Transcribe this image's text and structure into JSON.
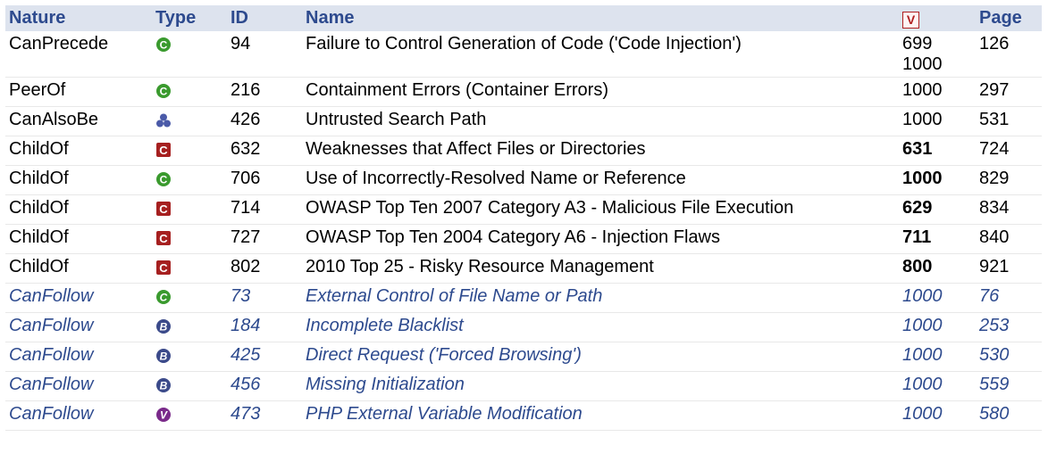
{
  "headers": {
    "nature": "Nature",
    "type": "Type",
    "id": "ID",
    "name": "Name",
    "view_icon": "V",
    "page": "Page"
  },
  "colors": {
    "header_bg": "#dde3ee",
    "header_text": "#2d4a8e",
    "inferred_text": "#2d4a8e",
    "class_icon": "#3a9a2e",
    "category_icon": "#a62020",
    "compound_icon": "#4a5aa8",
    "base_icon": "#3b4a8a",
    "variant_icon": "#7a2a8a"
  },
  "rows": [
    {
      "nature": "CanPrecede",
      "type_icon": "class-icon",
      "id": "94",
      "name": "Failure to Control Generation of Code ('Code Injection')",
      "views": [
        "699",
        "1000"
      ],
      "view_bold": false,
      "page": "126",
      "inferred": false
    },
    {
      "nature": "PeerOf",
      "type_icon": "class-icon",
      "id": "216",
      "name": "Containment Errors (Container Errors)",
      "views": [
        "1000"
      ],
      "view_bold": false,
      "page": "297",
      "inferred": false
    },
    {
      "nature": "CanAlsoBe",
      "type_icon": "compound-icon",
      "id": "426",
      "name": "Untrusted Search Path",
      "views": [
        "1000"
      ],
      "view_bold": false,
      "page": "531",
      "inferred": false
    },
    {
      "nature": "ChildOf",
      "type_icon": "category-icon",
      "id": "632",
      "name": "Weaknesses that Affect Files or Directories",
      "views": [
        "631"
      ],
      "view_bold": true,
      "page": "724",
      "inferred": false
    },
    {
      "nature": "ChildOf",
      "type_icon": "class-icon",
      "id": "706",
      "name": "Use of Incorrectly-Resolved Name or Reference",
      "views": [
        "1000"
      ],
      "view_bold": true,
      "page": "829",
      "inferred": false
    },
    {
      "nature": "ChildOf",
      "type_icon": "category-icon",
      "id": "714",
      "name": "OWASP Top Ten 2007 Category A3 - Malicious File Execution",
      "views": [
        "629"
      ],
      "view_bold": true,
      "page": "834",
      "inferred": false
    },
    {
      "nature": "ChildOf",
      "type_icon": "category-icon",
      "id": "727",
      "name": "OWASP Top Ten 2004 Category A6 - Injection Flaws",
      "views": [
        "711"
      ],
      "view_bold": true,
      "page": "840",
      "inferred": false
    },
    {
      "nature": "ChildOf",
      "type_icon": "category-icon",
      "id": "802",
      "name": "2010 Top 25 - Risky Resource Management",
      "views": [
        "800"
      ],
      "view_bold": true,
      "page": "921",
      "inferred": false
    },
    {
      "nature": "CanFollow",
      "type_icon": "class-icon",
      "id": "73",
      "name": "External Control of File Name or Path",
      "views": [
        "1000"
      ],
      "view_bold": false,
      "page": "76",
      "inferred": true
    },
    {
      "nature": "CanFollow",
      "type_icon": "base-icon",
      "id": "184",
      "name": "Incomplete Blacklist",
      "views": [
        "1000"
      ],
      "view_bold": false,
      "page": "253",
      "inferred": true
    },
    {
      "nature": "CanFollow",
      "type_icon": "base-icon",
      "id": "425",
      "name": "Direct Request ('Forced Browsing')",
      "views": [
        "1000"
      ],
      "view_bold": false,
      "page": "530",
      "inferred": true
    },
    {
      "nature": "CanFollow",
      "type_icon": "base-icon",
      "id": "456",
      "name": "Missing Initialization",
      "views": [
        "1000"
      ],
      "view_bold": false,
      "page": "559",
      "inferred": true
    },
    {
      "nature": "CanFollow",
      "type_icon": "variant-icon",
      "id": "473",
      "name": "PHP External Variable Modification",
      "views": [
        "1000"
      ],
      "view_bold": false,
      "page": "580",
      "inferred": true
    }
  ]
}
